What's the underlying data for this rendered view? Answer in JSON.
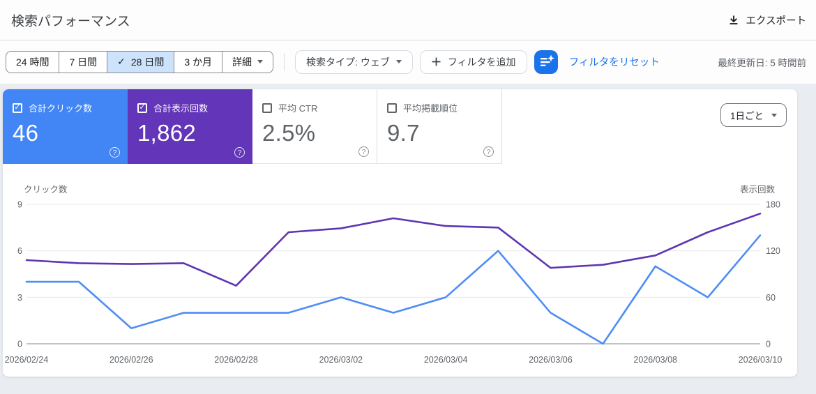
{
  "header": {
    "title": "検索パフォーマンス",
    "export_label": "エクスポート"
  },
  "glyphs": {
    "check": "✓",
    "help": "?"
  },
  "filters": {
    "date_ranges": [
      "24 時間",
      "7 日間",
      "28 日間",
      "3 か月"
    ],
    "selected_range": "28 日間",
    "detail_label": "詳細",
    "search_type_label": "検索タイプ: ウェブ",
    "add_filter_label": "フィルタを追加",
    "reset_label": "フィルタをリセット",
    "last_updated": "最終更新日: 5 時間前"
  },
  "metrics": [
    {
      "label": "合計クリック数",
      "value": "46",
      "checked": true,
      "color": "#4285f4"
    },
    {
      "label": "合計表示回数",
      "value": "1,862",
      "checked": true,
      "color": "#6335b8"
    },
    {
      "label": "平均 CTR",
      "value": "2.5%",
      "checked": false,
      "color": ""
    },
    {
      "label": "平均掲載順位",
      "value": "9.7",
      "checked": false,
      "color": ""
    }
  ],
  "granularity": {
    "label": "1日ごと"
  },
  "chart_data": {
    "type": "line",
    "x": [
      "2026/02/24",
      "2026/02/25",
      "2026/02/26",
      "2026/02/27",
      "2026/02/28",
      "2026/03/01",
      "2026/03/02",
      "2026/03/03",
      "2026/03/04",
      "2026/03/05",
      "2026/03/06",
      "2026/03/07",
      "2026/03/08",
      "2026/03/09",
      "2026/03/10"
    ],
    "x_tick_step": 2,
    "series": [
      {
        "name": "クリック数",
        "axis": "left",
        "color": "#4e8df5",
        "values": [
          4,
          4,
          1,
          2,
          2,
          2,
          3,
          2,
          3,
          6,
          2,
          0,
          5,
          3,
          7
        ]
      },
      {
        "name": "表示回数",
        "axis": "right",
        "color": "#5e35b1",
        "values": [
          108,
          104,
          103,
          104,
          75,
          144,
          149,
          162,
          152,
          150,
          98,
          102,
          114,
          144,
          168
        ]
      }
    ],
    "left_axis": {
      "label": "クリック数",
      "ticks": [
        0,
        3,
        6,
        9
      ],
      "max": 9
    },
    "right_axis": {
      "label": "表示回数",
      "ticks": [
        0,
        60,
        120,
        180
      ],
      "max": 180
    },
    "grid": true,
    "legend": "none"
  }
}
